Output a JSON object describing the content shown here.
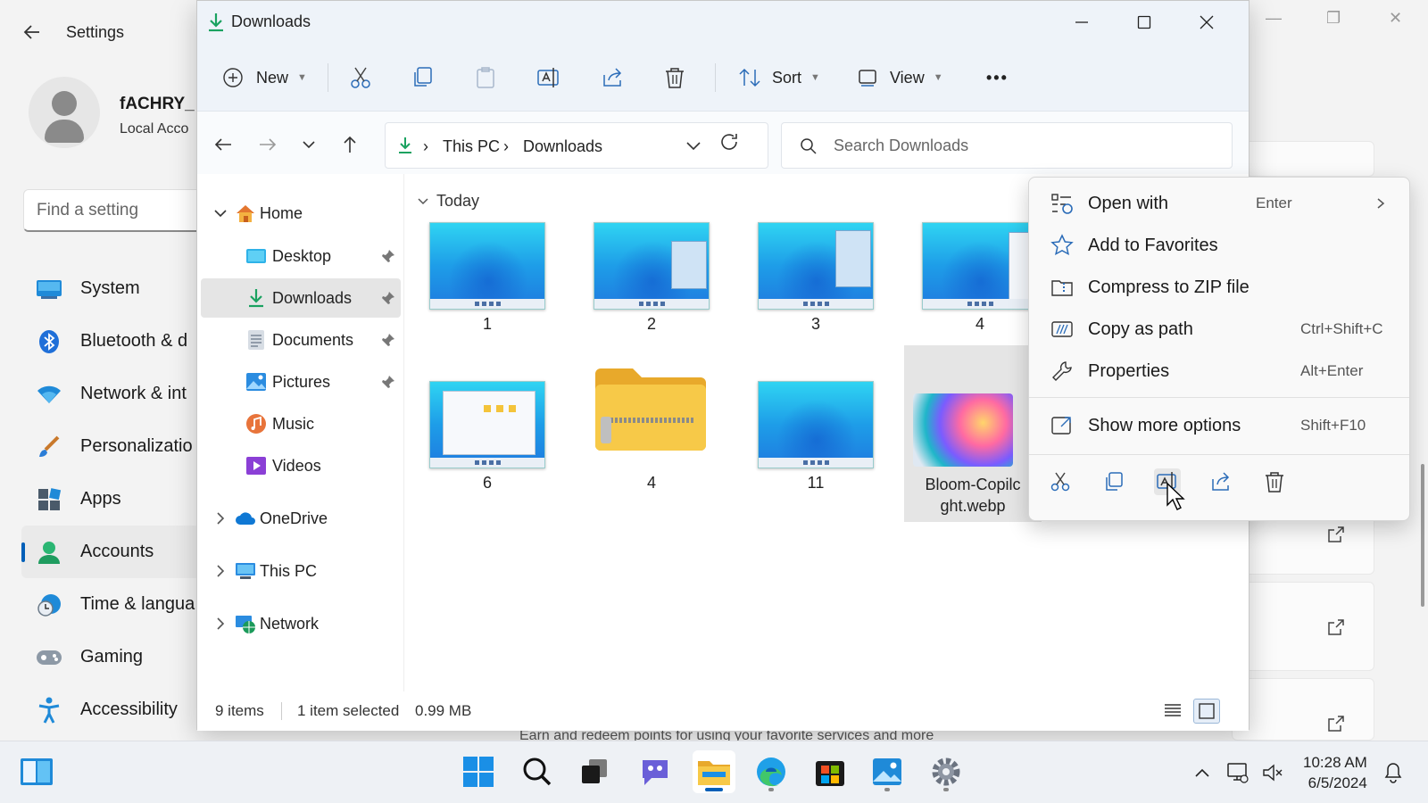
{
  "settings": {
    "title": "Settings",
    "user_name": "fACHRY_",
    "account_type": "Local Acco",
    "search_placeholder": "Find a setting",
    "nav": [
      {
        "label": "System",
        "icon": "monitor-icon"
      },
      {
        "label": "Bluetooth & d",
        "icon": "bluetooth-icon"
      },
      {
        "label": "Network & int",
        "icon": "wifi-icon"
      },
      {
        "label": "Personalizatio",
        "icon": "brush-icon"
      },
      {
        "label": "Apps",
        "icon": "apps-icon"
      },
      {
        "label": "Accounts",
        "icon": "person-icon",
        "active": true
      },
      {
        "label": "Time & langua",
        "icon": "clock-globe-icon"
      },
      {
        "label": "Gaming",
        "icon": "gamepad-icon"
      },
      {
        "label": "Accessibility",
        "icon": "accessibility-icon"
      }
    ],
    "bottom_text": "Earn and redeem points for using your favorite services and more"
  },
  "explorer": {
    "title": "Downloads",
    "toolbar": {
      "new_label": "New",
      "sort_label": "Sort",
      "view_label": "View",
      "more_label": "•••"
    },
    "breadcrumb": [
      "This PC",
      "Downloads"
    ],
    "search_placeholder": "Search Downloads",
    "sidebar": [
      {
        "label": "Home",
        "icon": "home-icon",
        "expanded": true
      },
      {
        "label": "Desktop",
        "icon": "desktop-folder-icon",
        "pinned": true
      },
      {
        "label": "Downloads",
        "icon": "downloads-icon",
        "pinned": true,
        "selected": true
      },
      {
        "label": "Documents",
        "icon": "documents-icon",
        "pinned": true
      },
      {
        "label": "Pictures",
        "icon": "pictures-icon",
        "pinned": true
      },
      {
        "label": "Music",
        "icon": "music-icon"
      },
      {
        "label": "Videos",
        "icon": "videos-icon"
      },
      {
        "label": "OneDrive",
        "icon": "cloud-icon"
      },
      {
        "label": "This PC",
        "icon": "computer-icon"
      },
      {
        "label": "Network",
        "icon": "network-icon"
      }
    ],
    "group_header": "Today",
    "files": [
      {
        "name": "1",
        "kind": "screenshot"
      },
      {
        "name": "2",
        "kind": "screenshot"
      },
      {
        "name": "3",
        "kind": "screenshot"
      },
      {
        "name": "4",
        "kind": "screenshot"
      },
      {
        "name": "6",
        "kind": "screenshot"
      },
      {
        "name": "4",
        "kind": "zip-folder"
      },
      {
        "name": "11",
        "kind": "screenshot"
      },
      {
        "name": "Bloom-Copilc",
        "name_line2": "ght.webp",
        "kind": "image",
        "selected": true
      }
    ],
    "status": {
      "item_count": "9 items",
      "selection": "1 item selected",
      "size": "0.99 MB"
    }
  },
  "context_menu": {
    "items": [
      {
        "label": "Open with",
        "shortcut": "Enter",
        "icon": "open-with-icon",
        "submenu": true
      },
      {
        "label": "Add to Favorites",
        "shortcut": "",
        "icon": "star-icon"
      },
      {
        "label": "Compress to ZIP file",
        "shortcut": "",
        "icon": "zip-icon"
      },
      {
        "label": "Copy as path",
        "shortcut": "Ctrl+Shift+C",
        "icon": "copy-path-icon"
      },
      {
        "label": "Properties",
        "shortcut": "Alt+Enter",
        "icon": "wrench-icon"
      },
      {
        "label": "Show more options",
        "shortcut": "Shift+F10",
        "icon": "more-options-icon"
      }
    ],
    "actions": [
      "cut-icon",
      "copy-icon",
      "rename-icon",
      "share-icon",
      "delete-icon"
    ]
  },
  "taskbar": {
    "apps": [
      "start-icon",
      "search-icon",
      "task-view-icon",
      "chat-icon",
      "file-explorer-icon",
      "edge-icon",
      "store-icon",
      "photos-icon",
      "settings-icon"
    ],
    "time": "10:28 AM",
    "date": "6/5/2024"
  },
  "colors": {
    "accent": "#005fb8",
    "folder": "#f4c43a",
    "selection": "#e5e5e5"
  }
}
